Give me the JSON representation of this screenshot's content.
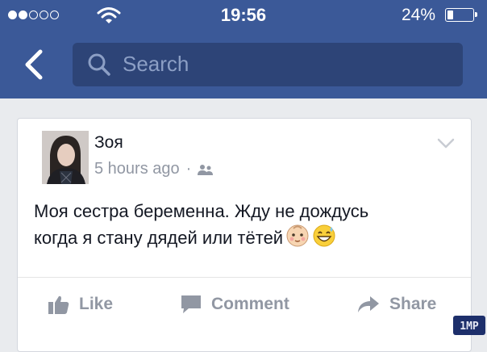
{
  "status_bar": {
    "time": "19:56",
    "battery_percent": "24%",
    "battery_level": 0.24,
    "signal_bars_filled": 2,
    "signal_bars_total": 5
  },
  "nav": {
    "search_placeholder": "Search",
    "back_icon": "chevron-left-icon",
    "color": "#3b5998"
  },
  "post": {
    "author": "Зоя",
    "timestamp": "5 hours ago",
    "separator": "·",
    "audience_icon": "friends-icon",
    "text_line1": "Моя сестра беременна. Жду не дождусь",
    "text_line2": "когда я стану дядей или тётей",
    "emojis": [
      "baby-face-emoji",
      "grinning-sweat-emoji"
    ]
  },
  "actions": {
    "like": "Like",
    "comment": "Comment",
    "share": "Share"
  },
  "watermark": "1MP"
}
